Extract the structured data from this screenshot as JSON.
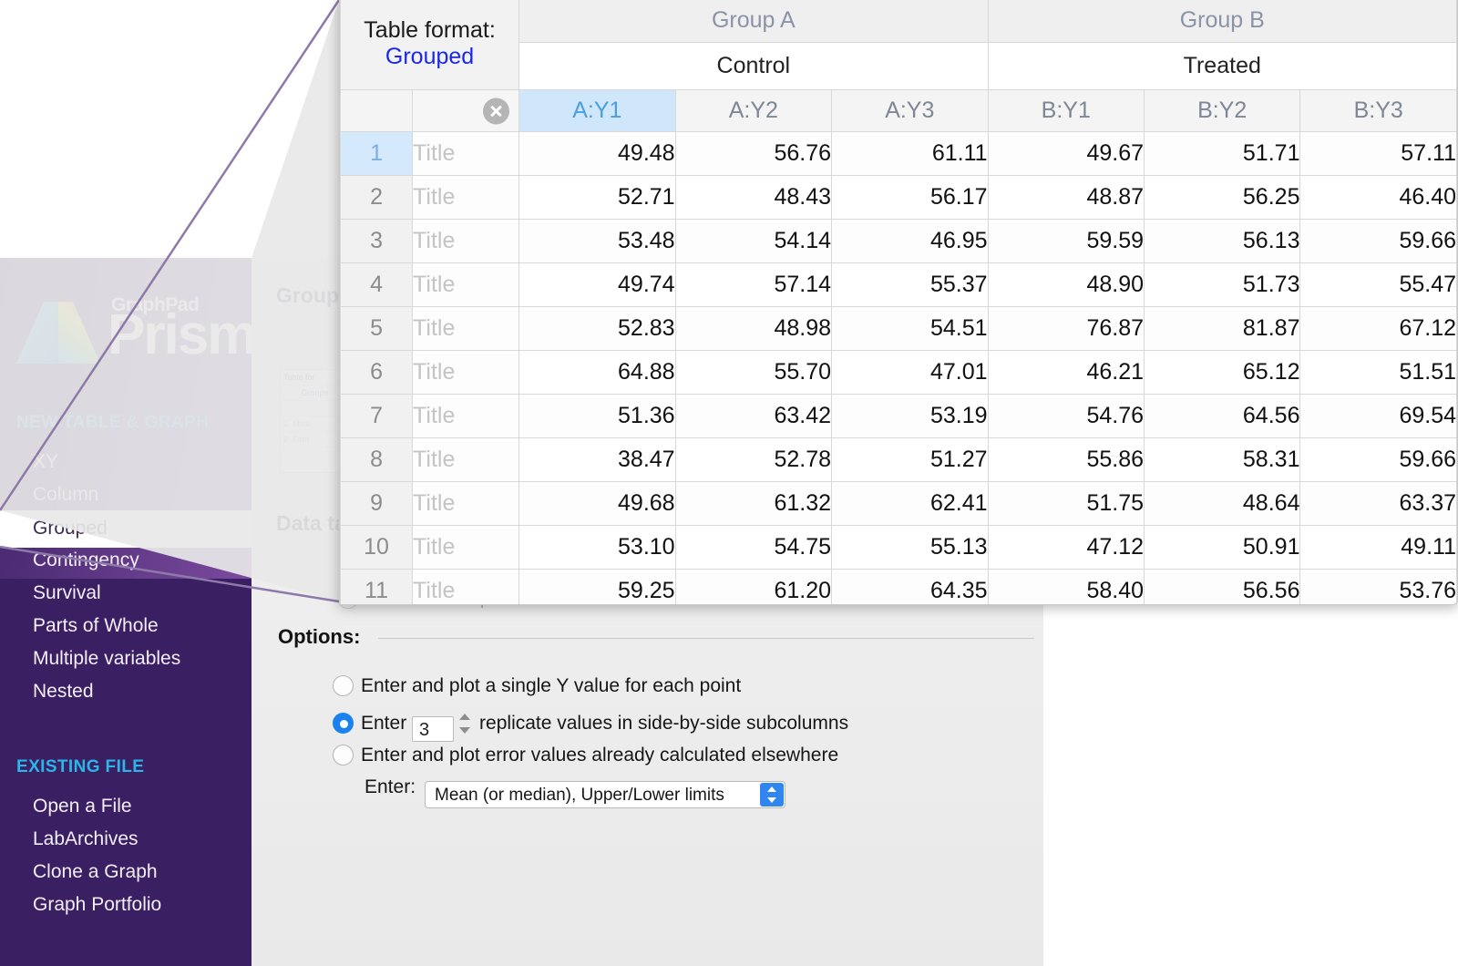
{
  "app": {
    "brand_top": "GraphPad",
    "brand_main": "Prism",
    "logo_icon": "prism-triangle-logo"
  },
  "sidebar": {
    "new_section_label": "NEW TABLE & GRAPH",
    "new_items": [
      {
        "label": "XY"
      },
      {
        "label": "Column"
      },
      {
        "label": "Grouped",
        "selected": true
      },
      {
        "label": "Contingency"
      },
      {
        "label": "Survival"
      },
      {
        "label": "Parts of Whole"
      },
      {
        "label": "Multiple variables"
      },
      {
        "label": "Nested"
      }
    ],
    "existing_section_label": "EXISTING FILE",
    "existing_items": [
      {
        "label": "Open a File"
      },
      {
        "label": "LabArchives"
      },
      {
        "label": "Clone a Graph"
      },
      {
        "label": "Graph Portfolio"
      }
    ]
  },
  "dialog_background": {
    "group_label": "Group",
    "data_table_label": "Data ta",
    "thumbnail": {
      "format_label": "Table for",
      "format_value": "Groupe",
      "row1_num": "1",
      "row1_text": "Male",
      "row2_num": "2",
      "row2_text": "Fem"
    },
    "obscured_radio_label": "Start with sample data to follow a tutorial"
  },
  "table": {
    "format_label": "Table format:",
    "format_value": "Grouped",
    "close_icon": "close-circle-icon",
    "group_headers": [
      {
        "label": "Group A",
        "span": 3
      },
      {
        "label": "Group B",
        "span": 3
      }
    ],
    "sub_headers": [
      {
        "label": "Control",
        "span": 3
      },
      {
        "label": "Treated",
        "span": 3
      }
    ],
    "column_headers": [
      "A:Y1",
      "A:Y2",
      "A:Y3",
      "B:Y1",
      "B:Y2",
      "B:Y3"
    ],
    "selected_column": "A:Y1",
    "title_placeholder": "Title",
    "active_cell": {
      "row": 1,
      "column": "A:Y1",
      "value": "49.48"
    },
    "rows": [
      {
        "n": "1",
        "title": "Title",
        "values": [
          "49.48",
          "56.76",
          "61.11",
          "49.67",
          "51.71",
          "57.11"
        ]
      },
      {
        "n": "2",
        "title": "Title",
        "values": [
          "52.71",
          "48.43",
          "56.17",
          "48.87",
          "56.25",
          "46.40"
        ]
      },
      {
        "n": "3",
        "title": "Title",
        "values": [
          "53.48",
          "54.14",
          "46.95",
          "59.59",
          "56.13",
          "59.66"
        ]
      },
      {
        "n": "4",
        "title": "Title",
        "values": [
          "49.74",
          "57.14",
          "55.37",
          "48.90",
          "51.73",
          "55.47"
        ]
      },
      {
        "n": "5",
        "title": "Title",
        "values": [
          "52.83",
          "48.98",
          "54.51",
          "76.87",
          "81.87",
          "67.12"
        ]
      },
      {
        "n": "6",
        "title": "Title",
        "values": [
          "64.88",
          "55.70",
          "47.01",
          "46.21",
          "65.12",
          "51.51"
        ]
      },
      {
        "n": "7",
        "title": "Title",
        "values": [
          "51.36",
          "63.42",
          "53.19",
          "54.76",
          "64.56",
          "69.54"
        ]
      },
      {
        "n": "8",
        "title": "Title",
        "values": [
          "38.47",
          "52.78",
          "51.27",
          "55.86",
          "58.31",
          "59.66"
        ]
      },
      {
        "n": "9",
        "title": "Title",
        "values": [
          "49.68",
          "61.32",
          "62.41",
          "51.75",
          "48.64",
          "63.37"
        ]
      },
      {
        "n": "10",
        "title": "Title",
        "values": [
          "53.10",
          "54.75",
          "55.13",
          "47.12",
          "50.91",
          "49.11"
        ]
      },
      {
        "n": "11",
        "title": "Title",
        "values": [
          "59.25",
          "61.20",
          "64.35",
          "58.40",
          "56.56",
          "53.76"
        ]
      }
    ]
  },
  "options": {
    "title": "Options:",
    "choices": [
      {
        "label": "Enter and plot a single Y value for each point",
        "selected": false
      },
      {
        "label_before": "Enter",
        "value": "3",
        "label_after": "replicate values in side-by-side subcolumns",
        "selected": true
      },
      {
        "label": "Enter and plot error values already calculated elsewhere",
        "selected": false
      }
    ],
    "enter_label": "Enter:",
    "enter_value": "Mean (or median), Upper/Lower limits"
  },
  "colors": {
    "sidebar_dark": "#3b1f63",
    "sidebar_light": "#7b4a9e",
    "accent_cyan": "#29b6e8",
    "selection_blue": "#3b7dd8",
    "header_sel_bg": "#cfe6fb",
    "link_blue": "#1a27e8"
  }
}
